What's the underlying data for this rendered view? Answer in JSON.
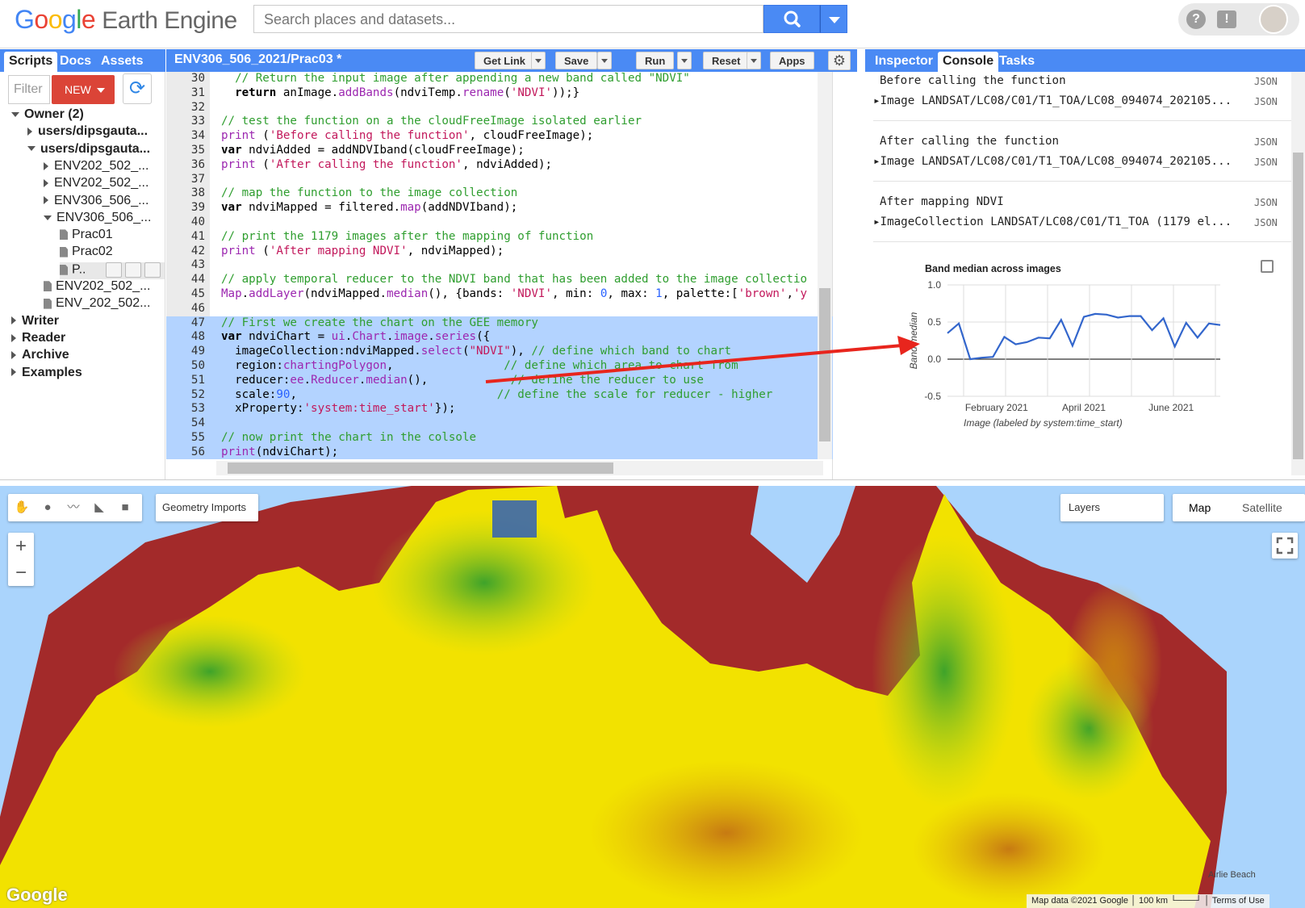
{
  "header": {
    "logo_google": [
      "G",
      "o",
      "o",
      "g",
      "l",
      "e"
    ],
    "logo_product": "Earth Engine",
    "search_placeholder": "Search places and datasets...",
    "help_icon": "help-icon",
    "feedback_icon": "feedback-icon"
  },
  "left_tabs": [
    "Scripts",
    "Docs",
    "Assets"
  ],
  "left_active_tab": "Scripts",
  "filter_placeholder": "Filter",
  "new_button": "NEW",
  "tree": [
    {
      "label": "Owner (2)",
      "indent": 0,
      "icon": "tri-d"
    },
    {
      "label": "users/dipsgauta...",
      "indent": 1,
      "icon": "tri-r"
    },
    {
      "label": "users/dipsgauta...",
      "indent": 1,
      "icon": "tri-d"
    },
    {
      "label": "ENV202_502_...",
      "indent": 2,
      "icon": "tri-r"
    },
    {
      "label": "ENV202_502_...",
      "indent": 2,
      "icon": "tri-r"
    },
    {
      "label": "ENV306_506_...",
      "indent": 2,
      "icon": "tri-r"
    },
    {
      "label": "ENV306_506_...",
      "indent": 2,
      "icon": "tri-d"
    },
    {
      "label": "Prac01",
      "indent": 3,
      "icon": "file"
    },
    {
      "label": "Prac02",
      "indent": 3,
      "icon": "file"
    },
    {
      "label": "P..",
      "indent": 3,
      "icon": "file",
      "selected": true
    },
    {
      "label": "ENV202_502_...",
      "indent": 2,
      "icon": "file"
    },
    {
      "label": "ENV_202_502...",
      "indent": 2,
      "icon": "file"
    },
    {
      "label": "Writer",
      "indent": 0,
      "icon": "tri-r"
    },
    {
      "label": "Reader",
      "indent": 0,
      "icon": "tri-r"
    },
    {
      "label": "Archive",
      "indent": 0,
      "icon": "tri-r"
    },
    {
      "label": "Examples",
      "indent": 0,
      "icon": "tri-r"
    }
  ],
  "editor": {
    "title": "ENV306_506_2021/Prac03 *",
    "buttons": {
      "get_link": "Get Link",
      "save": "Save",
      "run": "Run",
      "reset": "Reset",
      "apps": "Apps"
    },
    "lines": [
      {
        "n": "30",
        "html": "<span class='c-com'>  // Return the input image after appending a new band called \"NDVI\"</span>"
      },
      {
        "n": "31",
        "html": "  <b>return</b> anImage.<span class='c-fn'>addBands</span>(ndviTemp.<span class='c-fn'>rename</span>(<span class='c-str'>'NDVI'</span>));}"
      },
      {
        "n": "32",
        "html": ""
      },
      {
        "n": "33",
        "html": "<span class='c-com'>// test the function on a the cloudFreeImage isolated earlier</span>"
      },
      {
        "n": "34",
        "html": "<span class='c-fn'>print</span> (<span class='c-str'>'Before calling the function'</span>, cloudFreeImage);"
      },
      {
        "n": "35",
        "html": "<b>var</b> ndviAdded = addNDVIband(cloudFreeImage);"
      },
      {
        "n": "36",
        "html": "<span class='c-fn'>print</span> (<span class='c-str'>'After calling the function'</span>, ndviAdded);"
      },
      {
        "n": "37",
        "html": ""
      },
      {
        "n": "38",
        "html": "<span class='c-com'>// map the function to the image collection</span>"
      },
      {
        "n": "39",
        "html": "<b>var</b> ndviMapped = filtered.<span class='c-fn'>map</span>(addNDVIband);"
      },
      {
        "n": "40",
        "html": ""
      },
      {
        "n": "41",
        "html": "<span class='c-com'>// print the 1179 images after the mapping of function</span>"
      },
      {
        "n": "42",
        "html": "<span class='c-fn'>print</span> (<span class='c-str'>'After mapping NDVI'</span>, ndviMapped);"
      },
      {
        "n": "43",
        "html": ""
      },
      {
        "n": "44",
        "html": "<span class='c-com'>// apply temporal reducer to the NDVI band that has been added to the image collectio</span>"
      },
      {
        "n": "45",
        "html": "<span class='c-fn'>Map</span>.<span class='c-fn'>addLayer</span>(ndviMapped.<span class='c-fn'>median</span>(), {bands: <span class='c-str'>'NDVI'</span>, min: <span class='c-num'>0</span>, max: <span class='c-num'>1</span>, palette:[<span class='c-str'>'brown'</span>,<span class='c-str'>'y</span>"
      },
      {
        "n": "46",
        "html": ""
      },
      {
        "n": "47",
        "html": "<span class='c-com'>// First we create the chart on the GEE memory</span>",
        "sel": true
      },
      {
        "n": "48",
        "html": "<b>var</b> ndviChart = <span class='c-fn'>ui</span>.<span class='c-fn'>Chart</span>.<span class='c-fn'>image</span>.<span class='c-fn'>series</span>({",
        "sel": true
      },
      {
        "n": "49",
        "html": "  imageCollection:ndviMapped.<span class='c-fn'>select</span>(<span class='c-str'>\"NDVI\"</span>), <span class='c-com'>// define which band to chart</span>",
        "sel": true
      },
      {
        "n": "50",
        "html": "  region:<span class='c-fn'>chartingPolygon</span>,                <span class='c-com'>// define which area to chart from</span>",
        "sel": true
      },
      {
        "n": "51",
        "html": "  reducer:<span class='c-fn'>ee</span>.<span class='c-fn'>Reducer</span>.<span class='c-fn'>median</span>(),            <span class='c-com'>// define the reducer to use</span>",
        "sel": true
      },
      {
        "n": "52",
        "html": "  scale:<span class='c-num'>90</span>,                             <span class='c-com'>// define the scale for reducer - higher</span>",
        "sel": true
      },
      {
        "n": "53",
        "html": "  xProperty:<span class='c-str'>'system:time_start'</span>});",
        "sel": true
      },
      {
        "n": "54",
        "html": "",
        "sel": true
      },
      {
        "n": "55",
        "html": "<span class='c-com'>// now print the chart in the colsole</span>",
        "sel": true
      },
      {
        "n": "56",
        "html": "<span class='c-fn'>print</span>(ndviChart);",
        "sel": true
      }
    ]
  },
  "right_tabs": [
    "Inspector",
    "Console",
    "Tasks"
  ],
  "right_active_tab": "Console",
  "console": [
    {
      "label": "Before calling the function",
      "json": "JSON"
    },
    {
      "label": "Image LANDSAT/LC08/C01/T1_TOA/LC08_094074_202105...",
      "json": "JSON"
    },
    {
      "label": "After calling the function",
      "json": "JSON"
    },
    {
      "label": "Image LANDSAT/LC08/C01/T1_TOA/LC08_094074_202105...",
      "json": "JSON"
    },
    {
      "label": "After mapping NDVI",
      "json": "JSON"
    },
    {
      "label": "ImageCollection LANDSAT/LC08/C01/T1_TOA (1179 el...",
      "json": "JSON"
    }
  ],
  "chart_data": {
    "type": "line",
    "title": "Band median across images",
    "xlabel": "Image (labeled by system:time_start)",
    "ylabel": "Band median",
    "ylim": [
      -0.5,
      1.0
    ],
    "yticks": [
      1.0,
      0.5,
      0.0,
      -0.5
    ],
    "ytick_labels": [
      "1.0",
      "0.5",
      "0.0",
      "-0.5"
    ],
    "xtick_labels": [
      "February 2021",
      "April 2021",
      "June 2021"
    ],
    "xtick_positions": [
      0.18,
      0.5,
      0.82
    ],
    "grid": true,
    "color": "#3366cc",
    "series": [
      {
        "values": [
          0.35,
          0.48,
          0.0,
          0.02,
          0.03,
          0.3,
          0.2,
          0.23,
          0.29,
          0.28,
          0.53,
          0.18,
          0.57,
          0.61,
          0.6,
          0.56,
          0.58,
          0.58,
          0.39,
          0.55,
          0.17,
          0.49,
          0.29,
          0.48,
          0.46
        ]
      }
    ]
  },
  "map": {
    "geometry_imports": "Geometry Imports",
    "layers": "Layers",
    "map_type_active": "Map",
    "map_type_other": "Satellite",
    "zoom_in": "+",
    "zoom_out": "−",
    "google": "Google",
    "attribution": "Map data ©2021 Google │ 100 km └───┘ │ Terms of Use",
    "place_label": "Airlie Beach",
    "colors": {
      "water": "#aad4fc",
      "mask": "#a32a2a",
      "high": "#1e8c1e",
      "mid": "#f2e200",
      "low": "#c77a12",
      "polygon": "#2f5fb8"
    }
  },
  "annotation_arrow_color": "#e8251d"
}
